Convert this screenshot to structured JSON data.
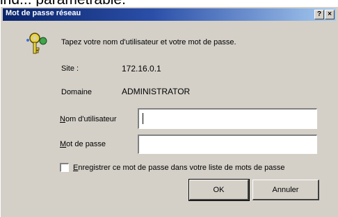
{
  "page_text": "ind... paramétrable.",
  "titlebar": {
    "title": "Mot de passe réseau",
    "help_label": "?",
    "close_label": "×"
  },
  "dialog": {
    "prompt": "Tapez votre nom d'utilisateur et votre mot de passe.",
    "site_label": "Site :",
    "site_value": "172.16.0.1",
    "domain_label": "Domaine",
    "domain_value": "ADMINISTRATOR",
    "user_label_first": "N",
    "user_label_rest": "om d'utilisateur",
    "user_value": "",
    "pass_label_first": "M",
    "pass_label_rest": "ot de passe",
    "pass_value": "",
    "save_label_first": "E",
    "save_label_rest": "nregistrer ce mot de passe dans votre liste de mots de passe",
    "ok_label": "OK",
    "cancel_label": "Annuler"
  },
  "colors": {
    "titlebar_start": "#0a246a",
    "titlebar_end": "#a6caf0",
    "dialog_face": "#d4d0c8"
  },
  "icons": {
    "key": "key-icon"
  }
}
